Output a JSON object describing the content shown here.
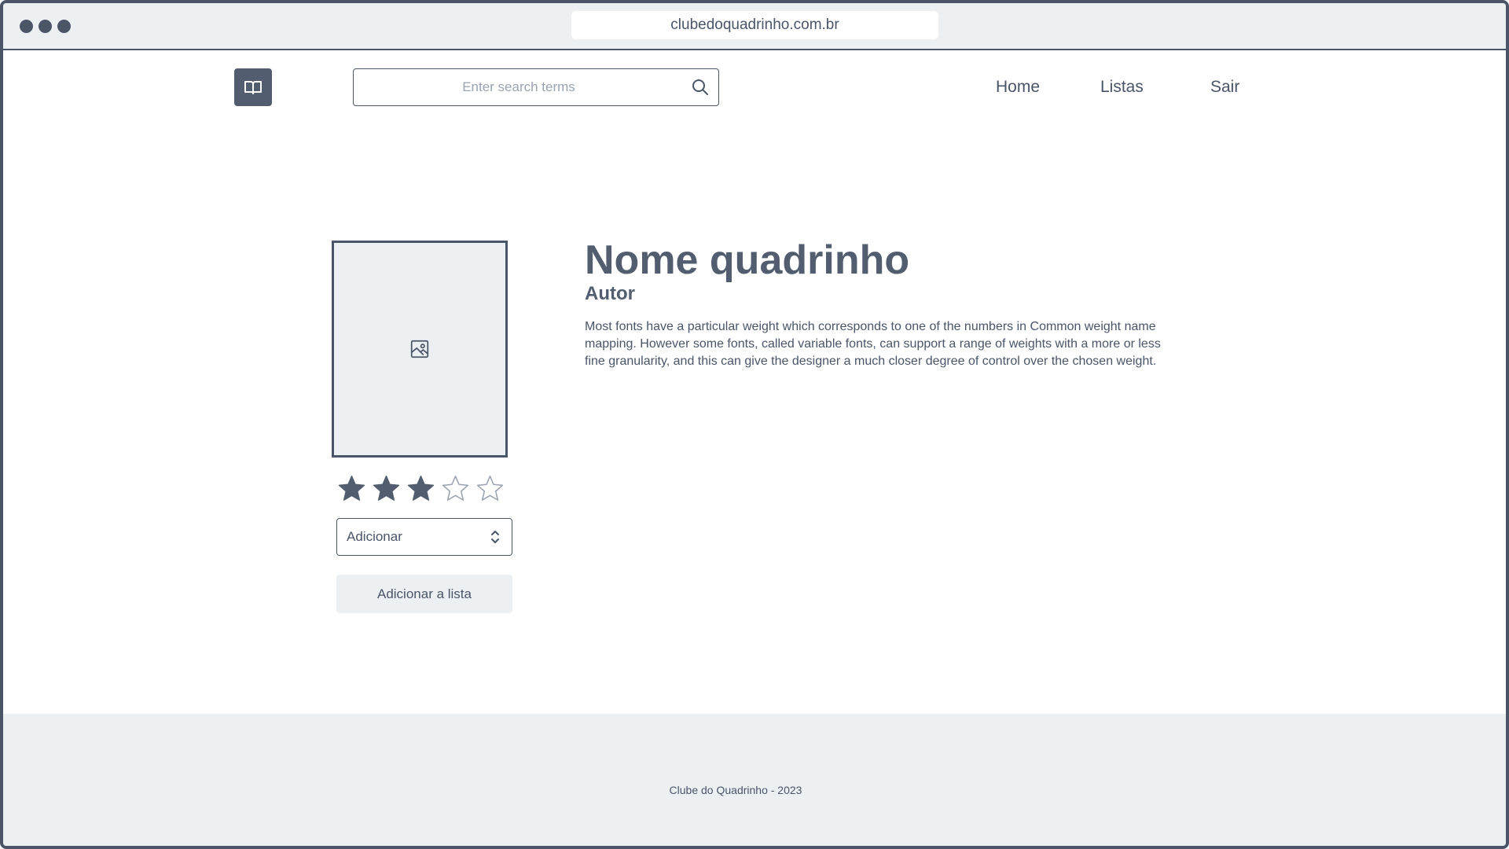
{
  "browser": {
    "url": "clubedoquadrinho.com.br"
  },
  "header": {
    "logo_icon": "open-book-icon",
    "search": {
      "placeholder": "Enter search terms",
      "value": "",
      "icon": "search-icon"
    },
    "nav": [
      {
        "label": "Home"
      },
      {
        "label": "Listas"
      },
      {
        "label": "Sair"
      }
    ]
  },
  "comic": {
    "cover_icon": "image-placeholder-icon",
    "title": "Nome quadrinho",
    "author": "Autor",
    "description": "Most fonts have a particular weight which corresponds to one of the numbers in Common weight name mapping. However some fonts, called variable fonts, can support a range of weights with a more or less fine granularity, and this can give the designer a much closer degree of control over the chosen weight.",
    "rating": {
      "value": 3,
      "max": 5
    },
    "list_select": {
      "value": "Adicionar",
      "icon": "chevron-up-down-icon"
    },
    "add_button_label": "Adicionar a lista"
  },
  "footer": {
    "text": "Clube do Quadrinho - 2023"
  },
  "colors": {
    "primary": "#4a5568",
    "surface": "#edf0f3",
    "star_filled": "#525e6f",
    "star_empty_stroke": "#9aa3af"
  }
}
